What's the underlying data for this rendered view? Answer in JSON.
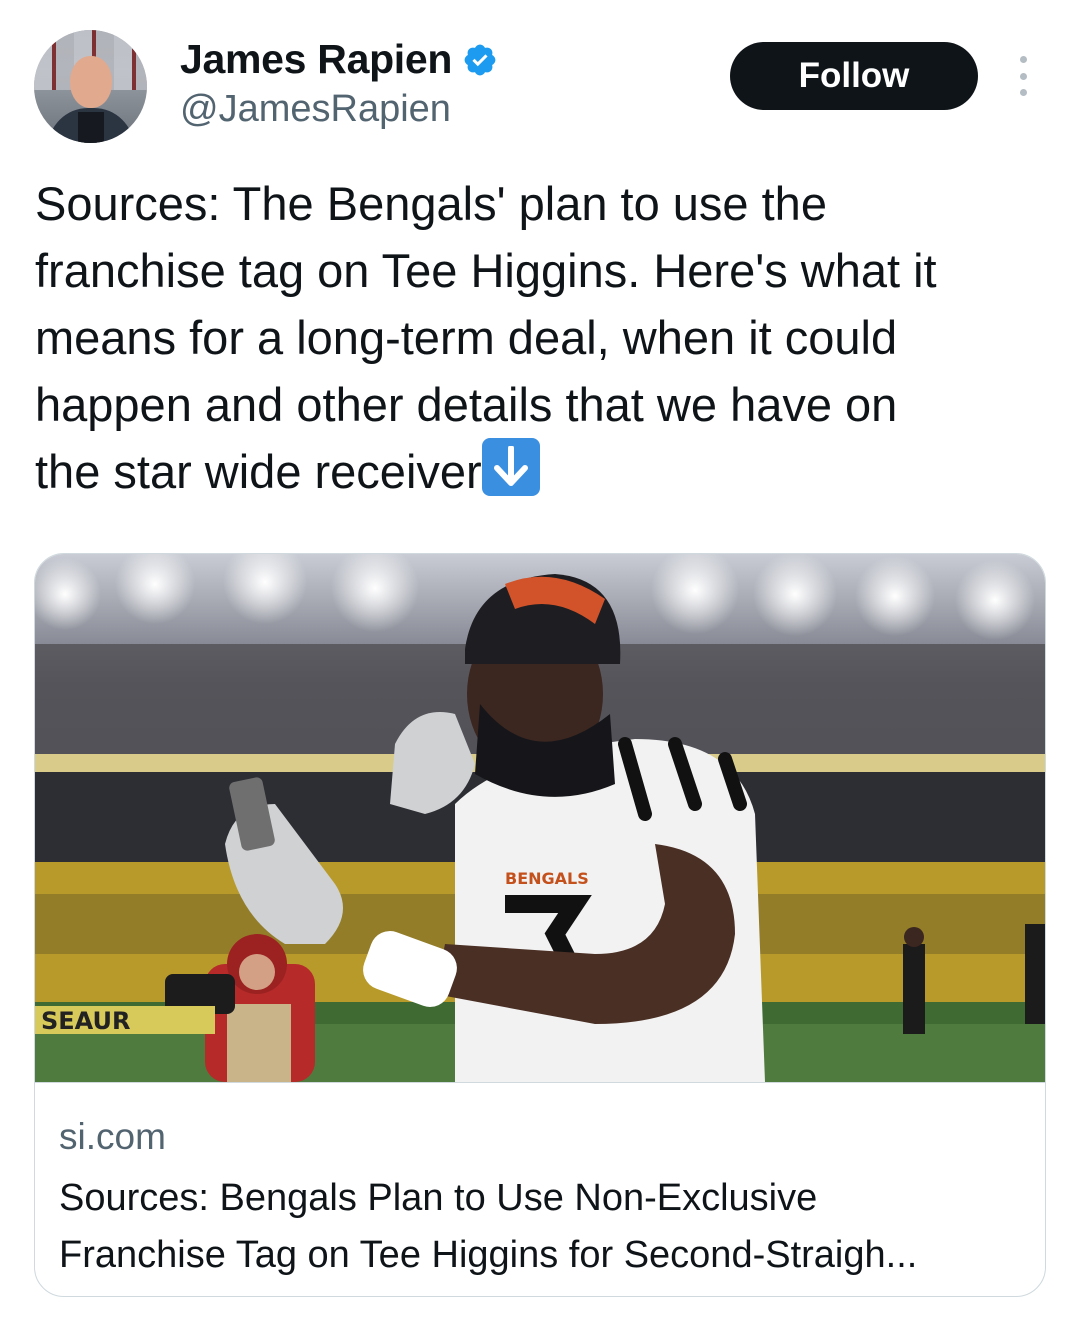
{
  "author": {
    "display_name": "James Rapien",
    "handle": "@JamesRapien",
    "verified": true
  },
  "actions": {
    "follow_label": "Follow"
  },
  "tweet": {
    "text": "Sources: The Bengals' plan to use the\nfranchise tag on Tee Higgins. Here's what it\nmeans for a long-term deal, when it could\nhappen and other details that we have on\nthe star wide receiver"
  },
  "link_card": {
    "domain": "si.com",
    "title_line1": "Sources: Bengals Plan to Use Non-Exclusive",
    "title_line2": "Franchise Tag on Tee Higgins for Second-Straigh..."
  },
  "colors": {
    "verified_blue": "#1d9bf0",
    "follow_bg": "#0f1419",
    "secondary_text": "#536471",
    "border": "#cfd9de"
  }
}
